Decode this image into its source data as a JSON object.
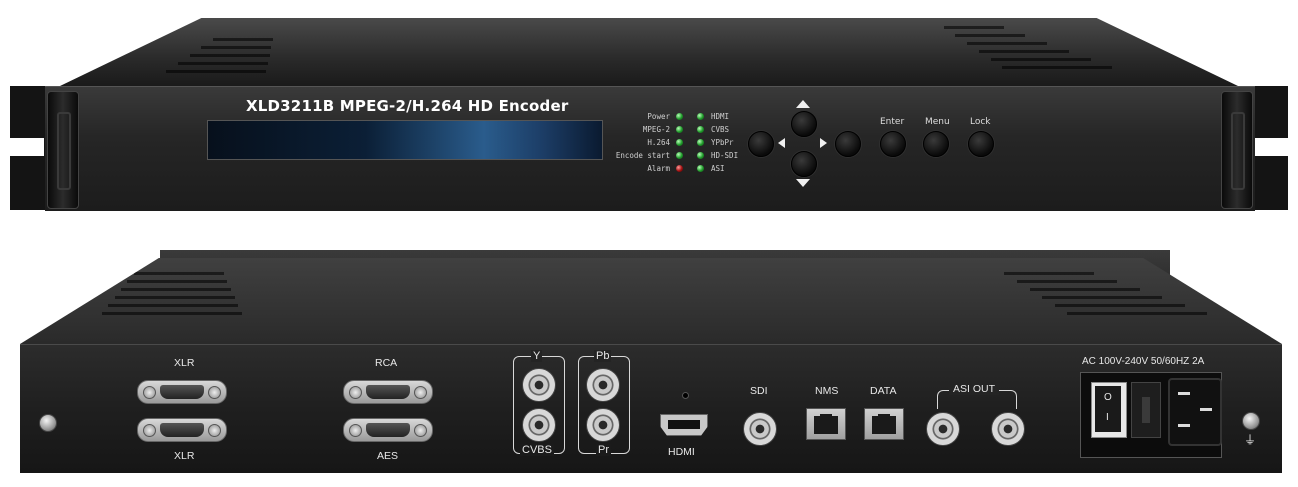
{
  "front": {
    "model_title": "XLD3211B MPEG-2/H.264 HD Encoder",
    "leds_left": [
      {
        "label": "Power",
        "color": "green"
      },
      {
        "label": "MPEG-2",
        "color": "green"
      },
      {
        "label": "H.264",
        "color": "green"
      },
      {
        "label": "Encode start",
        "color": "green"
      },
      {
        "label": "Alarm",
        "color": "red"
      }
    ],
    "leds_right": [
      {
        "label": "HDMI",
        "color": "green"
      },
      {
        "label": "CVBS",
        "color": "green"
      },
      {
        "label": "YPbPr",
        "color": "green"
      },
      {
        "label": "HD-SDI",
        "color": "green"
      },
      {
        "label": "ASI",
        "color": "green"
      }
    ],
    "buttons": {
      "enter": "Enter",
      "menu": "Menu",
      "lock": "Lock"
    }
  },
  "rear": {
    "xlr_top": "XLR",
    "xlr_bottom": "XLR",
    "rca": "RCA",
    "aes": "AES",
    "y": "Y",
    "pb": "Pb",
    "cvbs": "CVBS",
    "pr": "Pr",
    "hdmi": "HDMI",
    "sdi": "SDI",
    "nms": "NMS",
    "data": "DATA",
    "asi_out": "ASI  OUT",
    "power_rating": "AC 100V-240V 50/60HZ 2A",
    "switch_on": "I",
    "switch_off": "O"
  },
  "colors": {
    "chassis": "#1f1f1f",
    "led_green": "#1f9a2a",
    "led_red": "#a01010",
    "lcd_blue": "#2a5c8c"
  }
}
